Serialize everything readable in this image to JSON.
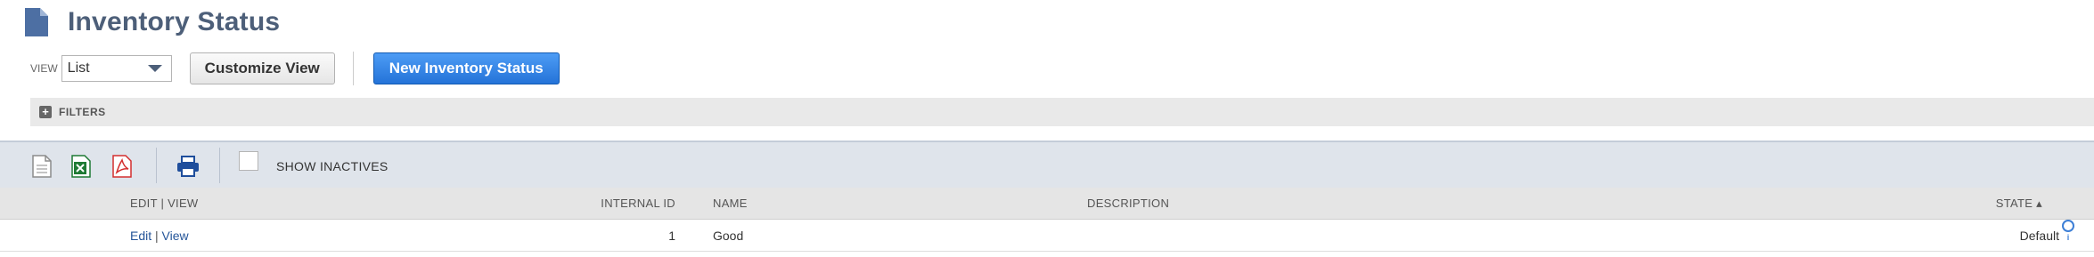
{
  "header": {
    "title": "Inventory Status",
    "icon": "document-icon"
  },
  "view": {
    "label": "VIEW",
    "selected": "List",
    "customize_label": "Customize View",
    "new_label": "New Inventory Status"
  },
  "filters": {
    "label": "FILTERS"
  },
  "toolbar": {
    "export_icons": [
      "csv-export-icon",
      "excel-export-icon",
      "pdf-export-icon",
      "print-icon"
    ],
    "show_inactives_label": "SHOW INACTIVES",
    "show_inactives_checked": false
  },
  "table": {
    "columns": {
      "edit_view": "EDIT | VIEW",
      "internal_id": "INTERNAL ID",
      "name": "NAME",
      "description": "DESCRIPTION",
      "state": "STATE ▴"
    },
    "rows": [
      {
        "edit": "Edit",
        "sep": "|",
        "view": "View",
        "internal_id": "1",
        "name": "Good",
        "description": "",
        "state": "Default"
      }
    ]
  },
  "colors": {
    "accent": "#2473d8",
    "title": "#4d5f79",
    "link": "#255599"
  }
}
